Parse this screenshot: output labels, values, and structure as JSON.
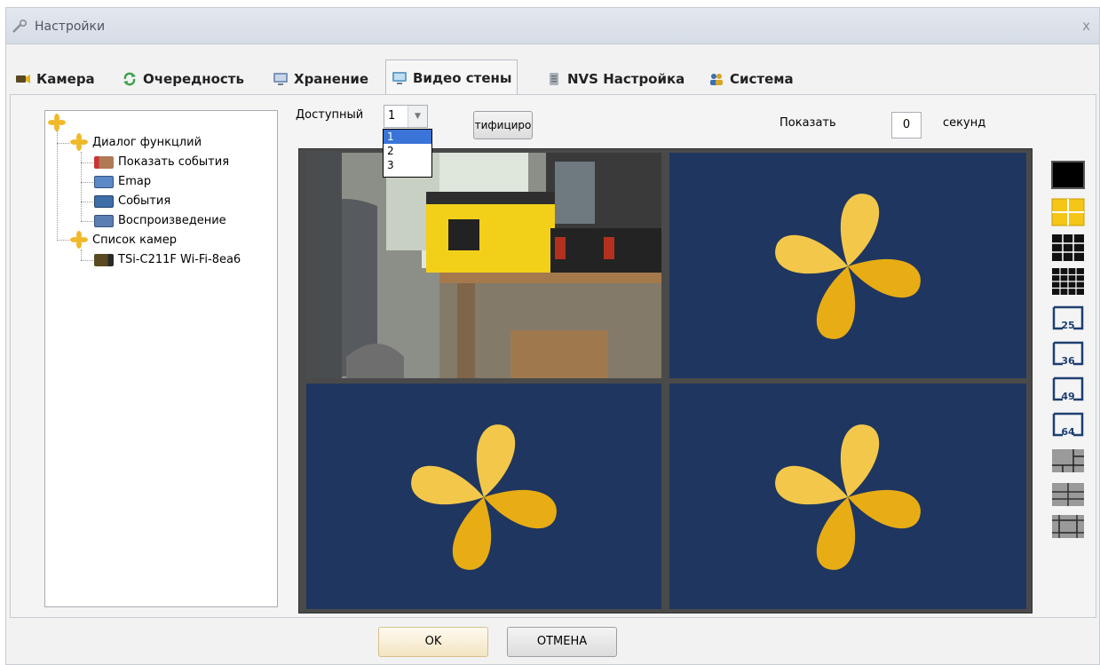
{
  "window": {
    "title": "Настройки",
    "close_glyph": "x"
  },
  "tabs": [
    {
      "label": "Камера",
      "icon": "camera-icon"
    },
    {
      "label": "Очередность",
      "icon": "refresh-icon"
    },
    {
      "label": "Хранение",
      "icon": "monitor-icon"
    },
    {
      "label": "Видео стены",
      "icon": "video-wall-icon",
      "active": true
    },
    {
      "label": "NVS Настройка",
      "icon": "server-icon"
    },
    {
      "label": "Система",
      "icon": "users-icon"
    }
  ],
  "tree": {
    "root_icon": "flower-icon",
    "groups": [
      {
        "label": "Диалог функцлий",
        "items": [
          {
            "label": "Показать события",
            "icon": "show-events-icon"
          },
          {
            "label": "Emap",
            "icon": "emap-icon"
          },
          {
            "label": "События",
            "icon": "events-icon"
          },
          {
            "label": "Воспроизведение",
            "icon": "playback-icon"
          }
        ]
      },
      {
        "label": "Список камер",
        "items": [
          {
            "label": "TSi-C211F Wi-Fi-8ea6",
            "icon": "camera-device-icon"
          }
        ]
      }
    ]
  },
  "controls": {
    "available_label": "Доступный",
    "available_value": "1",
    "available_options": [
      "1",
      "2",
      "3"
    ],
    "identify_button": "тифициро",
    "show_label": "Показать",
    "show_value": "0",
    "seconds_label": "секунд"
  },
  "video_wall": {
    "cells": [
      {
        "type": "camera-feed"
      },
      {
        "type": "empty",
        "icon": "flower-logo-icon"
      },
      {
        "type": "empty",
        "icon": "flower-logo-icon"
      },
      {
        "type": "empty",
        "icon": "flower-logo-icon"
      }
    ]
  },
  "layouts": {
    "labels": [
      "",
      "",
      "",
      "",
      "25",
      "36",
      "49",
      "64",
      "",
      "",
      ""
    ],
    "selected_index": 1
  },
  "footer": {
    "ok_label": "OK",
    "cancel_label": "ОТМЕНА"
  },
  "colors": {
    "wall_background": "#1f3660",
    "flower": "#f0b92a",
    "accent": "#f5c518"
  }
}
